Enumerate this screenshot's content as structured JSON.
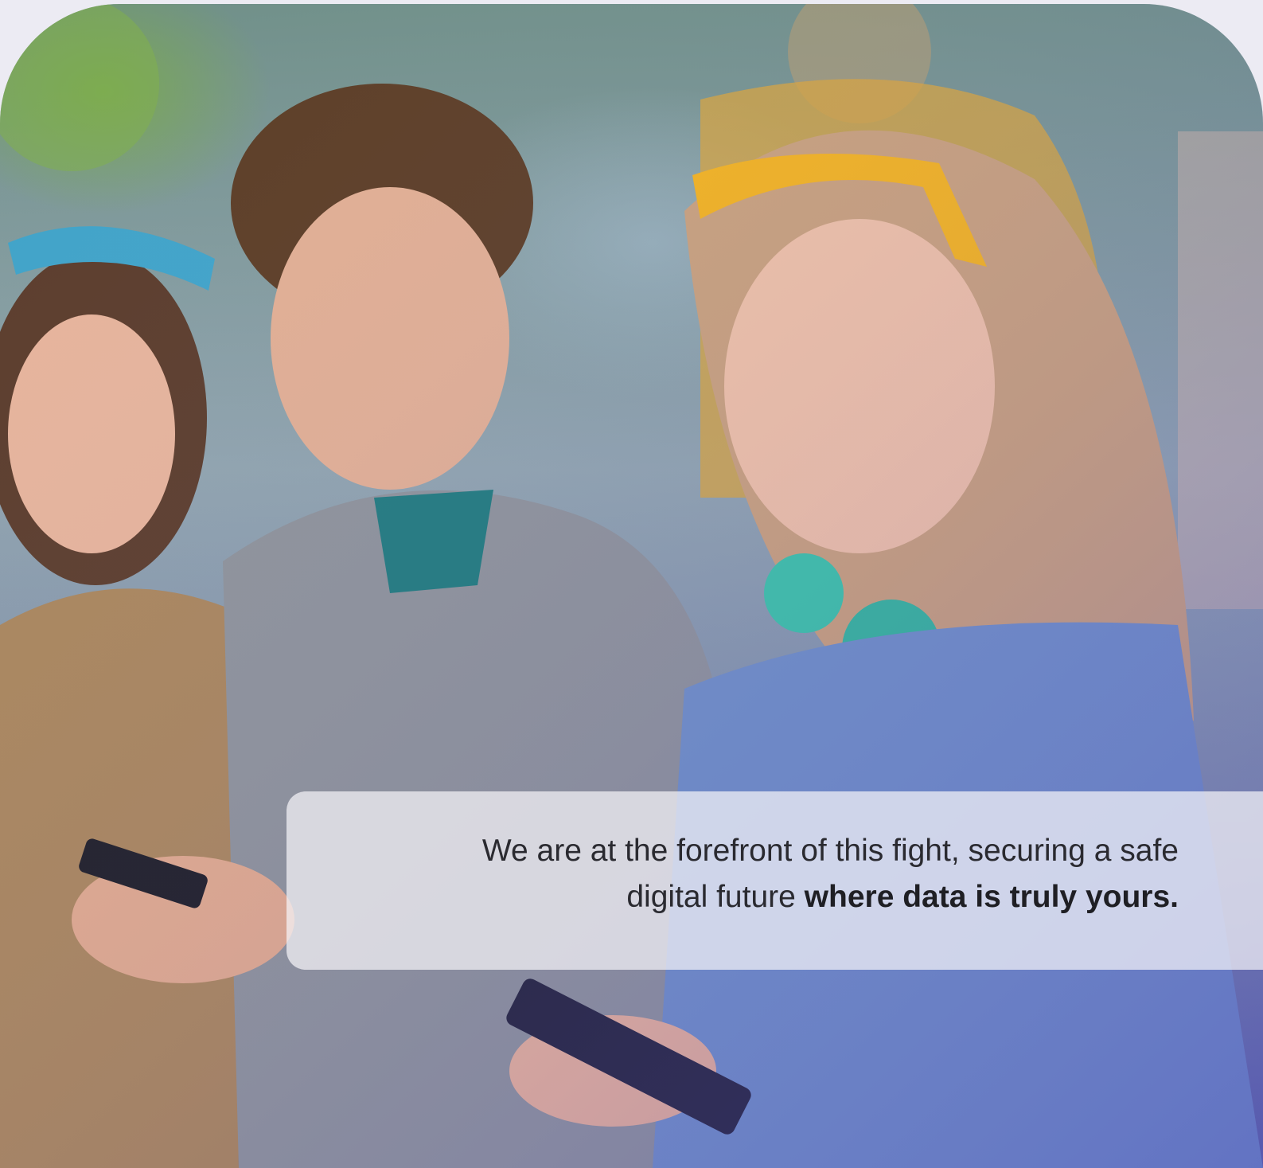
{
  "caption": {
    "line1": "We are at the forefront of this fight, securing a safe",
    "line2_regular": "digital future ",
    "line2_bold": "where data is truly yours."
  },
  "photo": {
    "icon": "photo-teens-with-phones"
  },
  "colors": {
    "caption_text": "#2a2a30",
    "caption_background": "#f5f4f8",
    "page_background": "#ecebf3"
  }
}
